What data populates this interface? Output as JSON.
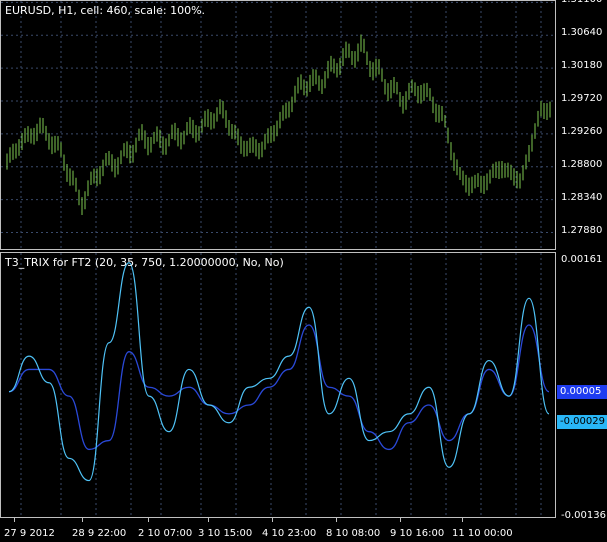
{
  "main_pane": {
    "title": "EURUSD, H1, cell: 460, scale: 100%."
  },
  "indicator_pane": {
    "title": "T3_TRIX for FT2 (20, 35, 750, 1.20000000, No, No)"
  },
  "main_yaxis": [
    "1.31100",
    "1.30640",
    "1.30180",
    "1.29720",
    "1.29260",
    "1.28800",
    "1.28340",
    "1.27880"
  ],
  "ind_yaxis": {
    "top": "0.00161",
    "bottom": "-0.00136"
  },
  "badges": {
    "dark_line_value": "0.00005",
    "light_line_value": "-0.00029"
  },
  "xaxis": [
    "27 9 2012",
    "28 9 22:00",
    "2 10 07:00",
    "3 10 15:00",
    "4 10 23:00",
    "8 10 08:00",
    "9 10 16:00",
    "11 10 00:00"
  ],
  "colors": {
    "bars": "#7ec850",
    "light_line": "#4fc3f7",
    "dark_line": "#2a49d8",
    "grid": "#3a4a6a",
    "badge_dark": "#1e3cf0",
    "badge_light": "#29b6f6"
  },
  "chart_data": [
    {
      "type": "bar",
      "title": "EURUSD, H1, cell: 460, scale: 100%.",
      "ylim": [
        1.2765,
        1.3112
      ],
      "x": [
        0,
        20,
        40,
        60,
        80,
        100,
        120,
        140,
        160,
        180,
        200,
        220,
        240,
        260,
        280,
        300,
        320,
        340,
        360,
        380,
        400,
        420,
        440,
        460,
        480,
        500,
        520,
        540
      ],
      "values": [
        1.2875,
        1.2915,
        1.2935,
        1.29,
        1.283,
        1.288,
        1.289,
        1.292,
        1.2915,
        1.2925,
        1.2935,
        1.296,
        1.291,
        1.2905,
        1.2945,
        1.2995,
        1.3,
        1.303,
        1.3045,
        1.3005,
        1.2975,
        1.299,
        1.2955,
        1.286,
        1.2855,
        1.288,
        1.286,
        1.296
      ]
    },
    {
      "type": "line",
      "title": "T3_TRIX for FT2 (20, 35, 750, 1.20000000, No, No)",
      "ylim": [
        -0.00136,
        0.00161
      ],
      "series": [
        {
          "values": [
            5e-05,
            0.00045,
            0.00015,
            -0.0007,
            -0.00095,
            0.0006,
            0.0015,
            0.0,
            -0.0004,
            0.0003,
            -0.0001,
            -0.0003,
            0.0001,
            0.0002,
            0.00045,
            0.001,
            -0.0002,
            0.0002,
            -0.0005,
            -0.0004,
            -0.0002,
            0.0001,
            -0.0008,
            -0.0002,
            0.0004,
            0.0,
            0.0011,
            -0.0002
          ]
        },
        {
          "values": [
            5e-05,
            0.0003,
            0.0003,
            0.0,
            -0.0006,
            -0.0005,
            0.0005,
            0.0001,
            0.0,
            0.0001,
            -0.0001,
            -0.0002,
            -0.0001,
            0.0001,
            0.0003,
            0.0008,
            0.0001,
            0.0,
            -0.0004,
            -0.0006,
            -0.0003,
            -0.0001,
            -0.0005,
            -0.0002,
            0.0003,
            0.0,
            0.0008,
            5e-05
          ]
        }
      ]
    }
  ]
}
